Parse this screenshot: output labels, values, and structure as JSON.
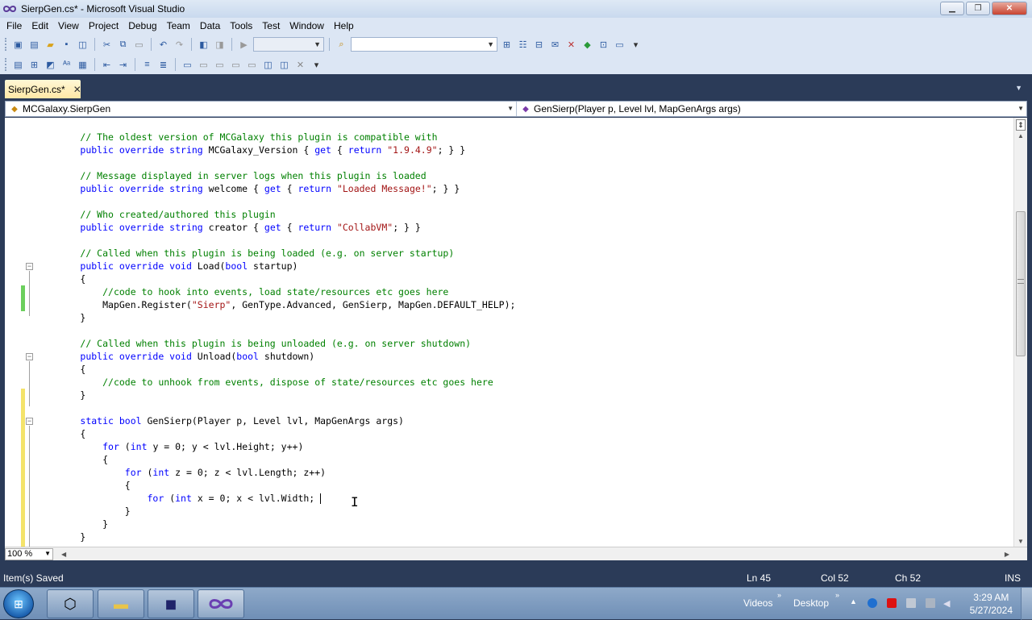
{
  "window": {
    "title": "SierpGen.cs* - Microsoft Visual Studio",
    "min_icon": "minimize-icon",
    "max_icon": "restore-icon",
    "close_icon": "close-icon"
  },
  "menu": [
    "File",
    "Edit",
    "View",
    "Project",
    "Debug",
    "Team",
    "Data",
    "Tools",
    "Test",
    "Window",
    "Help"
  ],
  "document_tab": {
    "label": "SierpGen.cs*",
    "close_glyph": "✕"
  },
  "navbar": {
    "type_combo": "MCGalaxy.SierpGen",
    "member_combo": "GenSierp(Player p, Level lvl, MapGenArgs args)"
  },
  "code_lines": [
    [
      {
        "t": "        "
      },
      {
        "c": "// The oldest version of MCGalaxy this plugin is compatible with"
      }
    ],
    [
      {
        "t": "        "
      },
      {
        "k": "public override string"
      },
      {
        "t": " MCGalaxy_Version { "
      },
      {
        "k": "get"
      },
      {
        "t": " { "
      },
      {
        "k": "return"
      },
      {
        "t": " "
      },
      {
        "s": "\"1.9.4.9\""
      },
      {
        "t": "; } }"
      }
    ],
    [],
    [
      {
        "t": "        "
      },
      {
        "c": "// Message displayed in server logs when this plugin is loaded"
      }
    ],
    [
      {
        "t": "        "
      },
      {
        "k": "public override string"
      },
      {
        "t": " welcome { "
      },
      {
        "k": "get"
      },
      {
        "t": " { "
      },
      {
        "k": "return"
      },
      {
        "t": " "
      },
      {
        "s": "\"Loaded Message!\""
      },
      {
        "t": "; } }"
      }
    ],
    [],
    [
      {
        "t": "        "
      },
      {
        "c": "// Who created/authored this plugin"
      }
    ],
    [
      {
        "t": "        "
      },
      {
        "k": "public override string"
      },
      {
        "t": " creator { "
      },
      {
        "k": "get"
      },
      {
        "t": " { "
      },
      {
        "k": "return"
      },
      {
        "t": " "
      },
      {
        "s": "\"CollabVM\""
      },
      {
        "t": "; } }"
      }
    ],
    [],
    [
      {
        "t": "        "
      },
      {
        "c": "// Called when this plugin is being loaded (e.g. on server startup)"
      }
    ],
    [
      {
        "t": "        "
      },
      {
        "k": "public override void"
      },
      {
        "t": " Load("
      },
      {
        "k": "bool"
      },
      {
        "t": " startup)"
      }
    ],
    [
      {
        "t": "        {"
      }
    ],
    [
      {
        "t": "            "
      },
      {
        "c": "//code to hook into events, load state/resources etc goes here"
      }
    ],
    [
      {
        "t": "            MapGen.Register("
      },
      {
        "s": "\"Sierp\""
      },
      {
        "t": ", GenType.Advanced, GenSierp, MapGen.DEFAULT_HELP);"
      }
    ],
    [
      {
        "t": "        }"
      }
    ],
    [],
    [
      {
        "t": "        "
      },
      {
        "c": "// Called when this plugin is being unloaded (e.g. on server shutdown)"
      }
    ],
    [
      {
        "t": "        "
      },
      {
        "k": "public override void"
      },
      {
        "t": " Unload("
      },
      {
        "k": "bool"
      },
      {
        "t": " shutdown)"
      }
    ],
    [
      {
        "t": "        {"
      }
    ],
    [
      {
        "t": "            "
      },
      {
        "c": "//code to unhook from events, dispose of state/resources etc goes here"
      }
    ],
    [
      {
        "t": "        }"
      }
    ],
    [],
    [
      {
        "t": "        "
      },
      {
        "k": "static bool"
      },
      {
        "t": " GenSierp(Player p, Level lvl, MapGenArgs args)"
      }
    ],
    [
      {
        "t": "        {"
      }
    ],
    [
      {
        "t": "            "
      },
      {
        "k": "for"
      },
      {
        "t": " ("
      },
      {
        "k": "int"
      },
      {
        "t": " y = 0; y < lvl.Height; y++)"
      }
    ],
    [
      {
        "t": "            {"
      }
    ],
    [
      {
        "t": "                "
      },
      {
        "k": "for"
      },
      {
        "t": " ("
      },
      {
        "k": "int"
      },
      {
        "t": " z = 0; z < lvl.Length; z++)"
      }
    ],
    [
      {
        "t": "                {"
      }
    ],
    [
      {
        "t": "                    "
      },
      {
        "k": "for"
      },
      {
        "t": " ("
      },
      {
        "k": "int"
      },
      {
        "t": " x = 0; x < lvl.Width; "
      },
      {
        "caret": true
      }
    ],
    [
      {
        "t": "                }"
      }
    ],
    [
      {
        "t": "            }"
      }
    ],
    [
      {
        "t": "        }"
      }
    ]
  ],
  "editor": {
    "zoom": "100 %"
  },
  "status": {
    "message": "Item(s) Saved",
    "line": "Ln 45",
    "col": "Col 52",
    "ch": "Ch 52",
    "mode": "INS"
  },
  "taskbar": {
    "tray_videos": "Videos",
    "tray_desktop": "Desktop",
    "time": "3:29 AM",
    "date": "5/27/2024"
  }
}
